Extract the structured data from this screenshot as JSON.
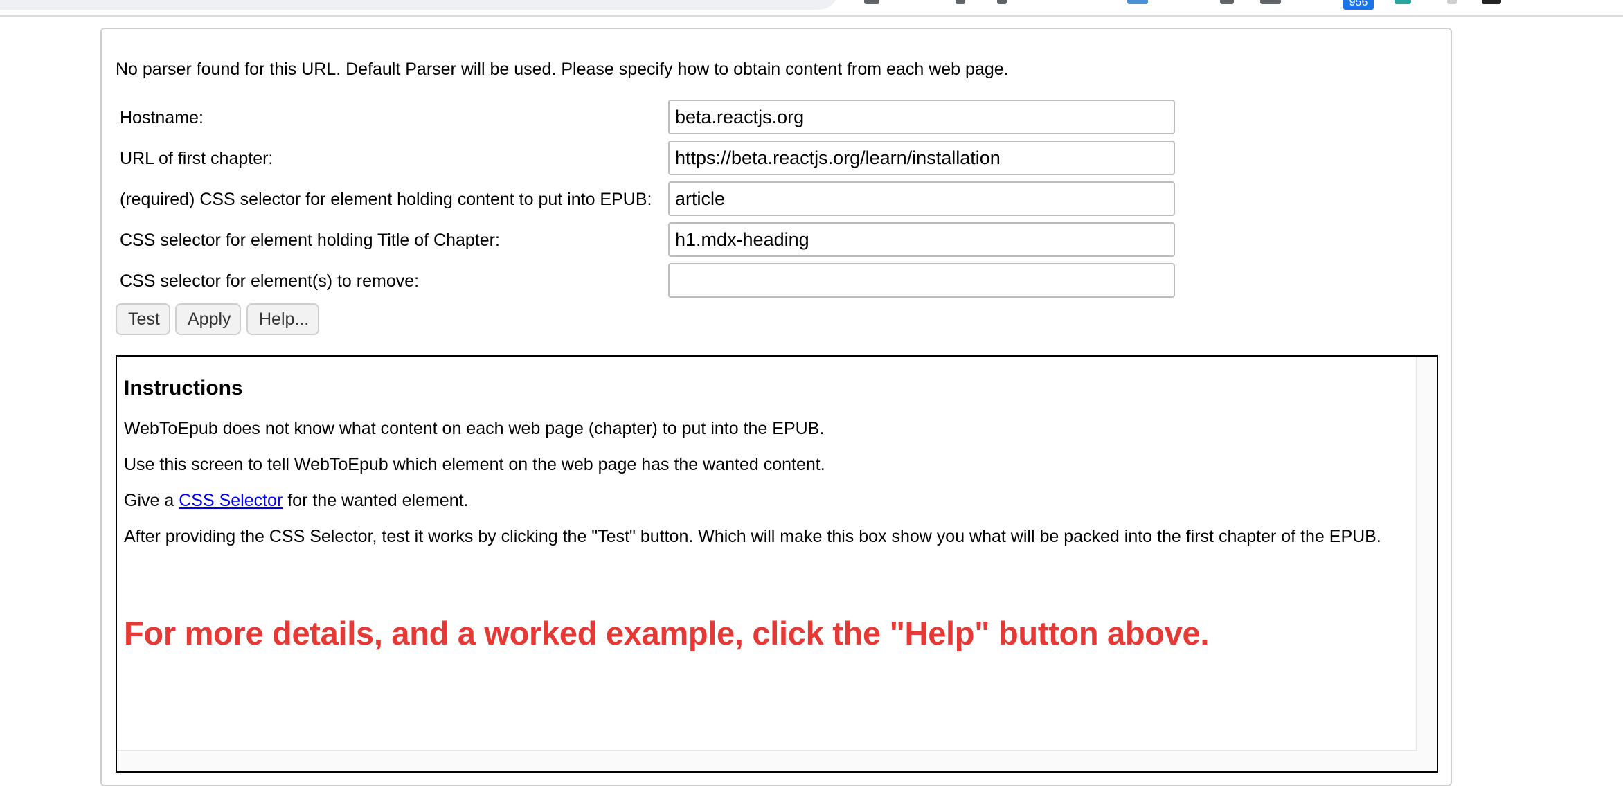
{
  "toolbar": {
    "badge_count": "956"
  },
  "parser": {
    "notice": "No parser found for this URL. Default Parser will be used. Please specify how to obtain content from each web page.",
    "fields": [
      {
        "label": "Hostname:",
        "value": "beta.reactjs.org"
      },
      {
        "label": "URL of first chapter:",
        "value": "https://beta.reactjs.org/learn/installation"
      },
      {
        "label": "(required) CSS selector for element holding content to put into EPUB:",
        "value": "article"
      },
      {
        "label": "CSS selector for element holding Title of Chapter:",
        "value": "h1.mdx-heading"
      },
      {
        "label": "CSS selector for element(s) to remove:",
        "value": ""
      }
    ],
    "buttons": {
      "test": "Test",
      "apply": "Apply",
      "help": "Help..."
    }
  },
  "instructions": {
    "title": "Instructions",
    "p1": "WebToEpub does not know what content on each web page (chapter) to put into the EPUB.",
    "p2": "Use this screen to tell WebToEpub which element on the web page has the wanted content.",
    "p3_before": "Give a",
    "p3_link": "CSS Selector",
    "p3_after": "for the wanted element.",
    "p4": "After providing the CSS Selector, test it works by clicking the \"Test\" button. Which will make this box show you what will be packed into the first chapter of the EPUB.",
    "callout": "For more details, and a worked example, click the \"Help\" button above."
  },
  "colors": {
    "callout": "#e53935",
    "link": "#0000ee",
    "badge": "#1a73e8"
  }
}
